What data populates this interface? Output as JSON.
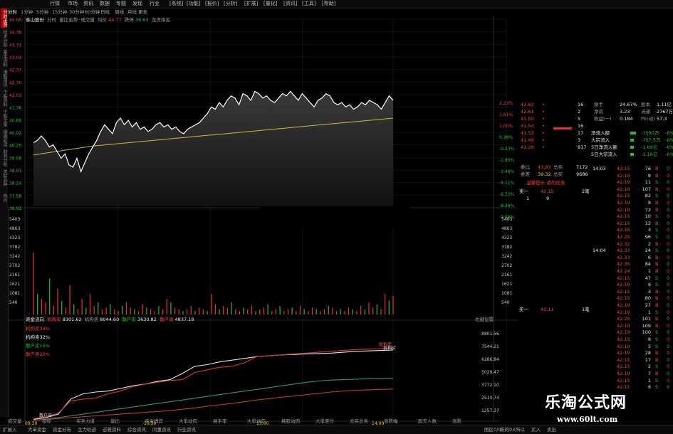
{
  "top_menu": [
    "行情",
    "市场",
    "资讯",
    "数据",
    "专题",
    "发现",
    "行业",
    "[系统]",
    "[功能]",
    "[报价]",
    "[分析]",
    "[扩展]",
    "[量化]",
    "[资讯]",
    "[工具]",
    "[帮助]"
  ],
  "period_tabs": [
    "分时",
    "1分钟",
    "5分钟",
    "15分钟",
    "30分钟",
    "60分钟",
    "日线",
    "周线",
    "月线",
    "更多"
  ],
  "left_tabs": [
    "分时走势",
    "技术分析",
    "基本资料",
    "港股资讯",
    "个股资料",
    "个股全景",
    "操盘必读",
    "财务分析",
    "关联品种",
    "热点"
  ],
  "info_line": {
    "name": "泰山股份",
    "mode": "分时",
    "tool": "量比走势",
    "vol_label": "成交量",
    "avg_label": "均价",
    "avg_value": "44.77",
    "pct_label": "跌停",
    "pct_value": "36.63",
    "extra": "龙虎排名"
  },
  "price_ticks": [
    "45.05",
    "44.38",
    "43.71",
    "43.04",
    "42.37",
    "42.70",
    "42.03",
    "41.36",
    "40.69",
    "40.02",
    "40.25",
    "39.58",
    "38.91",
    "38.24",
    "37.58",
    "36.92"
  ],
  "pct_ticks": [
    "2.23%",
    "1.61%",
    "1.00%",
    "0.38%",
    "-0.23%",
    "-1.85%",
    "-3.48%",
    "-5.11%",
    "-6.73%",
    "-8.36%",
    "-9.98%"
  ],
  "vol_ticks_left": [
    "5403",
    "4863",
    "4323",
    "3782",
    "3242",
    "2702",
    "2161",
    "1621",
    "1081",
    "540"
  ],
  "vol_ticks_right": [
    "5403",
    "4863",
    "4323",
    "3782",
    "3242",
    "2702",
    "2161",
    "1621",
    "1081",
    "540"
  ],
  "flow_header": {
    "label": "资金流向",
    "jg_buy_label": "机构买",
    "jg_buy": "8301.62",
    "jg_sell_label": "机构卖",
    "jg_sell": "8044.60",
    "sh_buy_label": "散户买",
    "sh_buy": "3630.82",
    "sh_sell_label": "散户卖",
    "sh_sell": "4837.18",
    "settings": "右键设置"
  },
  "flow_legend": [
    "机构买34%",
    "机构卖32%",
    "散户买15%",
    "散户卖20%"
  ],
  "flow_ticks": [
    "8801.56",
    "7544.21",
    "6286.84",
    "5029.47",
    "3772.10",
    "2514.74",
    "1257.37"
  ],
  "flow_tags": [
    "机构卖",
    "机构买",
    "散户买"
  ],
  "time_ticks": [
    "09:30",
    "10:30",
    "13:00",
    "14:00"
  ],
  "orderbook": {
    "sell_prices": [
      "42.62",
      "42.61",
      "41.55",
      "41.54",
      "41.53",
      "41.49",
      "41.29"
    ],
    "sell_vols": [
      "16",
      "2",
      "5",
      "16",
      "17",
      "3",
      "817"
    ],
    "bid_total_label": "委比",
    "bid_total": "43.83",
    "sum_label": "总卖",
    "sum_val": "7172",
    "ask_total_label": "委差",
    "ask_total": "39.32",
    "sum2_label": "总买",
    "sum2_val": "9686",
    "notice": "温馨提示:请勿追涨",
    "sell1_label": "卖一",
    "sell1_price": "42.15",
    "sell1_vol": "2笔",
    "buy1_label": "买一",
    "buy1_price": "42.11",
    "buy1_vol": "1笔",
    "row_a": "1",
    "row_b": "9"
  },
  "stats": [
    {
      "k": "换手",
      "v": "24.67%",
      "k2": "股本",
      "v2": "1.11亿"
    },
    {
      "k": "净资",
      "v": "3.23",
      "k2": "流通",
      "v2": "2767万"
    },
    {
      "k": "收益(一)",
      "v": "0.184",
      "k2": "PE(动)",
      "v2": "57.3"
    }
  ],
  "moneyflow": [
    {
      "k": "净流入额",
      "v": "-1590万",
      "p": "-6%"
    },
    {
      "k": "大宗流入",
      "v": "-757.5万",
      "p": "-6%"
    },
    {
      "k": "5日净流入额",
      "v": "-1.69亿",
      "p": "-6%"
    },
    {
      "k": "5日大宗流入",
      "v": "-1.16亿",
      "p": "-6%"
    }
  ],
  "tick_times": [
    "14:03",
    "",
    "",
    "",
    "",
    "",
    "",
    "",
    "",
    "",
    "",
    "",
    "14:04",
    "",
    "",
    "",
    "",
    "",
    "",
    "",
    "",
    "",
    "",
    "",
    "",
    "",
    "",
    "",
    "",
    "",
    "",
    "",
    "",
    ""
  ],
  "tick_prices": [
    "42.15",
    "42.19",
    "42.19",
    "42.19",
    "42.15",
    "42.19",
    "42.19",
    "42.15",
    "42.15",
    "42.16",
    "42.25",
    "42.32",
    "42.33",
    "42.33",
    "42.35",
    "42.24",
    "42.15",
    "42.19",
    "42.15",
    "42.15",
    "42.19",
    "42.19",
    "42.20",
    "42.19",
    "42.19",
    "42.15",
    "42.19",
    "42.19",
    "42.15",
    "42.15",
    "42.19",
    "42.15",
    "42.15",
    "42.18"
  ],
  "tick_vols": [
    "76",
    "8",
    "11",
    "107",
    "82",
    "8",
    "72",
    "10",
    "12",
    "3",
    "96",
    "2",
    "24",
    "6",
    "84",
    "1",
    "47",
    "6",
    "3",
    "80",
    "27",
    "1",
    "101",
    "109",
    "100",
    "8",
    "5",
    "28",
    "17",
    "2",
    "7",
    "1",
    "6",
    "2"
  ],
  "tick_sides": [
    "B",
    "B",
    "S",
    "B",
    "S",
    "B",
    "B",
    "S",
    "B",
    "S",
    "S",
    "B",
    "S",
    "B",
    "B",
    "B",
    "S",
    "S",
    "B",
    "B",
    "B",
    "S",
    "B",
    "B",
    "S",
    "S",
    "S",
    "B",
    "B",
    "S",
    "B",
    "S",
    "S",
    "B"
  ],
  "bottom_menu": [
    "扩展入",
    "大单资金",
    "资金分布",
    "主力轨迹",
    "逆差资料",
    "综合资讯",
    "问董资讯",
    "行业资讯"
  ],
  "bottom_right": [
    "图区0/0",
    "新的03",
    "所以",
    "买入",
    "卖出"
  ],
  "bottom_tabs": [
    "成交量",
    "指标",
    "买卖力道",
    "量比",
    "资金博弈",
    "大单动向",
    "换手率",
    "大单动向",
    "换股动因",
    "大单差分",
    "总买总卖",
    "涨跌幅",
    "股东人数",
    "涨跌"
  ],
  "watermark": {
    "title": "乐淘公式网",
    "url": "www.60lt.com"
  },
  "colors": {
    "price_line": "#ffffff",
    "avg_line": "#c8b84a",
    "up": "#ff3b3b",
    "down": "#19c919",
    "jg_buy": "#e23030",
    "jg_sell": "#d9e9ef",
    "sh_buy": "#2b9a7a",
    "sh_sell": "#c23a2a"
  }
}
